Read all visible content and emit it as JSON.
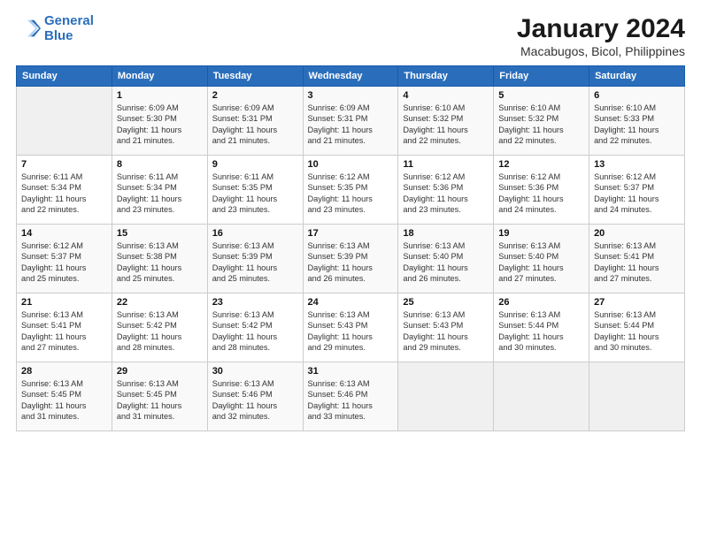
{
  "header": {
    "logo_line1": "General",
    "logo_line2": "Blue",
    "title": "January 2024",
    "subtitle": "Macabugos, Bicol, Philippines"
  },
  "weekdays": [
    "Sunday",
    "Monday",
    "Tuesday",
    "Wednesday",
    "Thursday",
    "Friday",
    "Saturday"
  ],
  "weeks": [
    [
      {
        "day": "",
        "info": ""
      },
      {
        "day": "1",
        "info": "Sunrise: 6:09 AM\nSunset: 5:30 PM\nDaylight: 11 hours\nand 21 minutes."
      },
      {
        "day": "2",
        "info": "Sunrise: 6:09 AM\nSunset: 5:31 PM\nDaylight: 11 hours\nand 21 minutes."
      },
      {
        "day": "3",
        "info": "Sunrise: 6:09 AM\nSunset: 5:31 PM\nDaylight: 11 hours\nand 21 minutes."
      },
      {
        "day": "4",
        "info": "Sunrise: 6:10 AM\nSunset: 5:32 PM\nDaylight: 11 hours\nand 22 minutes."
      },
      {
        "day": "5",
        "info": "Sunrise: 6:10 AM\nSunset: 5:32 PM\nDaylight: 11 hours\nand 22 minutes."
      },
      {
        "day": "6",
        "info": "Sunrise: 6:10 AM\nSunset: 5:33 PM\nDaylight: 11 hours\nand 22 minutes."
      }
    ],
    [
      {
        "day": "7",
        "info": "Sunrise: 6:11 AM\nSunset: 5:34 PM\nDaylight: 11 hours\nand 22 minutes."
      },
      {
        "day": "8",
        "info": "Sunrise: 6:11 AM\nSunset: 5:34 PM\nDaylight: 11 hours\nand 23 minutes."
      },
      {
        "day": "9",
        "info": "Sunrise: 6:11 AM\nSunset: 5:35 PM\nDaylight: 11 hours\nand 23 minutes."
      },
      {
        "day": "10",
        "info": "Sunrise: 6:12 AM\nSunset: 5:35 PM\nDaylight: 11 hours\nand 23 minutes."
      },
      {
        "day": "11",
        "info": "Sunrise: 6:12 AM\nSunset: 5:36 PM\nDaylight: 11 hours\nand 23 minutes."
      },
      {
        "day": "12",
        "info": "Sunrise: 6:12 AM\nSunset: 5:36 PM\nDaylight: 11 hours\nand 24 minutes."
      },
      {
        "day": "13",
        "info": "Sunrise: 6:12 AM\nSunset: 5:37 PM\nDaylight: 11 hours\nand 24 minutes."
      }
    ],
    [
      {
        "day": "14",
        "info": "Sunrise: 6:12 AM\nSunset: 5:37 PM\nDaylight: 11 hours\nand 25 minutes."
      },
      {
        "day": "15",
        "info": "Sunrise: 6:13 AM\nSunset: 5:38 PM\nDaylight: 11 hours\nand 25 minutes."
      },
      {
        "day": "16",
        "info": "Sunrise: 6:13 AM\nSunset: 5:39 PM\nDaylight: 11 hours\nand 25 minutes."
      },
      {
        "day": "17",
        "info": "Sunrise: 6:13 AM\nSunset: 5:39 PM\nDaylight: 11 hours\nand 26 minutes."
      },
      {
        "day": "18",
        "info": "Sunrise: 6:13 AM\nSunset: 5:40 PM\nDaylight: 11 hours\nand 26 minutes."
      },
      {
        "day": "19",
        "info": "Sunrise: 6:13 AM\nSunset: 5:40 PM\nDaylight: 11 hours\nand 27 minutes."
      },
      {
        "day": "20",
        "info": "Sunrise: 6:13 AM\nSunset: 5:41 PM\nDaylight: 11 hours\nand 27 minutes."
      }
    ],
    [
      {
        "day": "21",
        "info": "Sunrise: 6:13 AM\nSunset: 5:41 PM\nDaylight: 11 hours\nand 27 minutes."
      },
      {
        "day": "22",
        "info": "Sunrise: 6:13 AM\nSunset: 5:42 PM\nDaylight: 11 hours\nand 28 minutes."
      },
      {
        "day": "23",
        "info": "Sunrise: 6:13 AM\nSunset: 5:42 PM\nDaylight: 11 hours\nand 28 minutes."
      },
      {
        "day": "24",
        "info": "Sunrise: 6:13 AM\nSunset: 5:43 PM\nDaylight: 11 hours\nand 29 minutes."
      },
      {
        "day": "25",
        "info": "Sunrise: 6:13 AM\nSunset: 5:43 PM\nDaylight: 11 hours\nand 29 minutes."
      },
      {
        "day": "26",
        "info": "Sunrise: 6:13 AM\nSunset: 5:44 PM\nDaylight: 11 hours\nand 30 minutes."
      },
      {
        "day": "27",
        "info": "Sunrise: 6:13 AM\nSunset: 5:44 PM\nDaylight: 11 hours\nand 30 minutes."
      }
    ],
    [
      {
        "day": "28",
        "info": "Sunrise: 6:13 AM\nSunset: 5:45 PM\nDaylight: 11 hours\nand 31 minutes."
      },
      {
        "day": "29",
        "info": "Sunrise: 6:13 AM\nSunset: 5:45 PM\nDaylight: 11 hours\nand 31 minutes."
      },
      {
        "day": "30",
        "info": "Sunrise: 6:13 AM\nSunset: 5:46 PM\nDaylight: 11 hours\nand 32 minutes."
      },
      {
        "day": "31",
        "info": "Sunrise: 6:13 AM\nSunset: 5:46 PM\nDaylight: 11 hours\nand 33 minutes."
      },
      {
        "day": "",
        "info": ""
      },
      {
        "day": "",
        "info": ""
      },
      {
        "day": "",
        "info": ""
      }
    ]
  ]
}
